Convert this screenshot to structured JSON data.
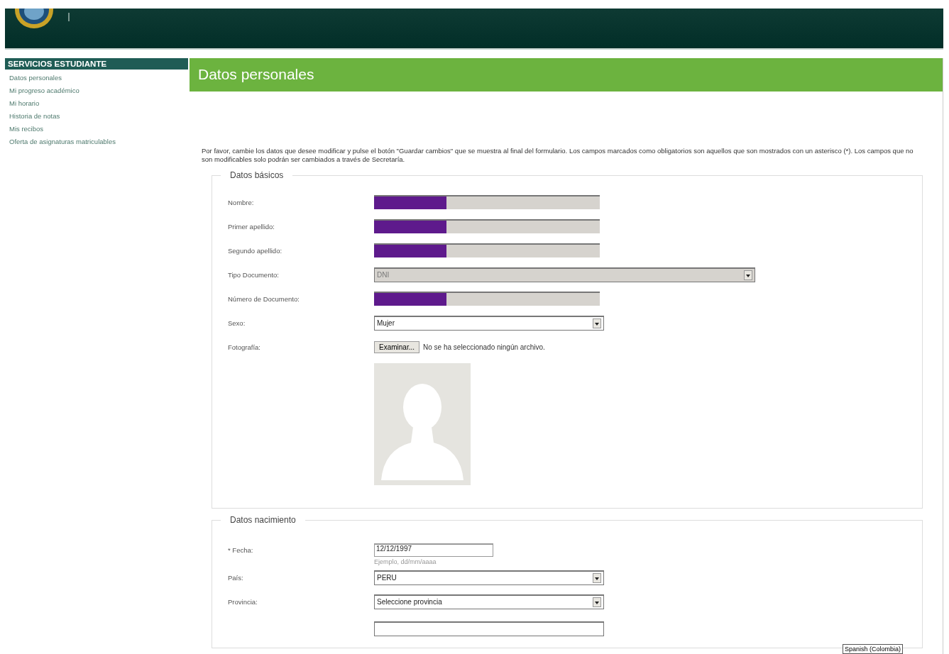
{
  "sidebar": {
    "title": "SERVICIOS ESTUDIANTE",
    "items": [
      {
        "label": "Datos personales"
      },
      {
        "label": "Mi progreso académico"
      },
      {
        "label": "Mi horario"
      },
      {
        "label": "Historia de notas"
      },
      {
        "label": "Mis recibos"
      },
      {
        "label": "Oferta de asignaturas matriculables"
      }
    ]
  },
  "page_title": "Datos personales",
  "intro": "Por favor, cambie los datos que desee modificar y pulse el botón \"Guardar cambios\" que se muestra al final del formulario. Los campos marcados como obligatorios son aquellos que son mostrados con un asterisco (*). Los campos que no son modificables solo podrán ser cambiados a través de Secretaría.",
  "sections": [
    {
      "legend": "Datos básicos",
      "fields": [
        {
          "kind": "text",
          "label": "Nombre:",
          "redacted": true
        },
        {
          "kind": "text",
          "label": "Primer apellido:",
          "redacted": true
        },
        {
          "kind": "text",
          "label": "Segundo apellido:",
          "redacted": true
        },
        {
          "kind": "select",
          "label": "Tipo Documento:",
          "value": "DNI",
          "disabled": true,
          "wide": true
        },
        {
          "kind": "text",
          "label": "Número de Documento:",
          "redacted": true
        },
        {
          "kind": "select",
          "label": "Sexo:",
          "value": "Mujer",
          "disabled": false
        },
        {
          "kind": "file",
          "label": "Fotografía:",
          "button": "Examinar...",
          "status": "No se ha seleccionado ningún archivo."
        },
        {
          "kind": "photo"
        }
      ]
    },
    {
      "legend": "Datos nacimiento",
      "fields": [
        {
          "kind": "date",
          "label": "* Fecha:",
          "value": "12/12/1997",
          "hint": "Ejemplo, dd/mm/aaaa"
        },
        {
          "kind": "select",
          "label": "País:",
          "value": "PERU",
          "disabled": false
        },
        {
          "kind": "select",
          "label": "Provincia:",
          "value": "Seleccione provincia",
          "disabled": false
        },
        {
          "kind": "select"
        }
      ]
    }
  ],
  "language_button": "Spanish (Colombia)"
}
